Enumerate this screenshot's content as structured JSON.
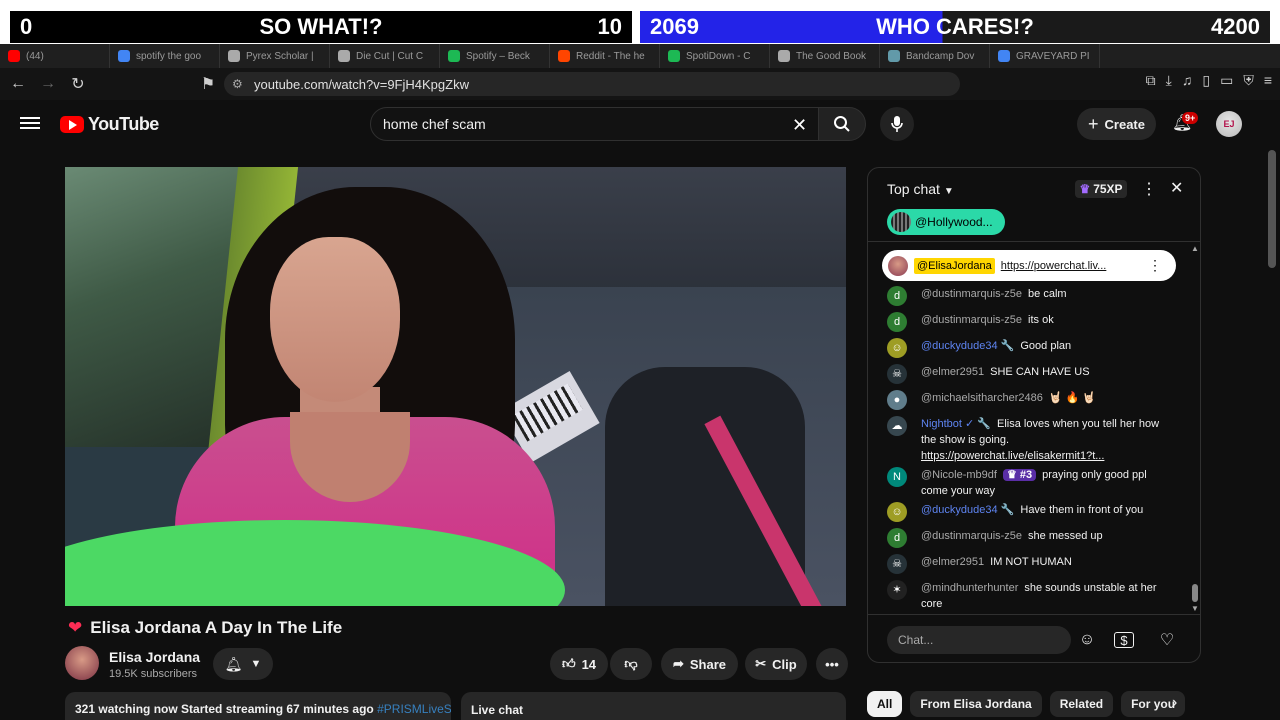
{
  "scoreboard": {
    "left": {
      "score_a": "0",
      "title": "SO WHAT!?",
      "score_b": "10"
    },
    "right": {
      "score_a": "2069",
      "title": "WHO CARES!?",
      "score_b": "4200"
    }
  },
  "tabs": [
    {
      "label": "(44)",
      "color": "#ff0000"
    },
    {
      "label": "spotify the goo",
      "color": "#4285f4"
    },
    {
      "label": "Pyrex Scholar |",
      "color": "#aaaaaa"
    },
    {
      "label": "Die Cut | Cut C",
      "color": "#aaaaaa"
    },
    {
      "label": "Spotify – Beck",
      "color": "#1db954"
    },
    {
      "label": "Reddit - The he",
      "color": "#ff4500"
    },
    {
      "label": "SpotiDown - C",
      "color": "#1db954"
    },
    {
      "label": "The Good Book",
      "color": "#aaaaaa"
    },
    {
      "label": "Bandcamp Dov",
      "color": "#629aa9"
    },
    {
      "label": "GRAVEYARD PI",
      "color": "#4285f4"
    }
  ],
  "browser": {
    "url": "youtube.com/watch?v=9FjH4KpgZkw"
  },
  "header": {
    "logo_text": "YouTube",
    "search_query": "home chef scam",
    "create_label": "Create",
    "notif_count": "9+"
  },
  "video": {
    "title": "Elisa Jordana A Day In The Life",
    "channel": "Elisa Jordana",
    "subscribers": "19.5K subscribers",
    "likes": "14",
    "share_label": "Share",
    "clip_label": "Clip",
    "info_bar": "321 watching now  Started streaming 67 minutes ago",
    "info_tag": "#PRISMLiveSt",
    "live_chat_label": "Live chat"
  },
  "chat": {
    "header": "Top chat",
    "xp": "75XP",
    "hollywood": "@Hollywood...",
    "pinned_author": "@ElisaJordana",
    "pinned_link": "https://powerchat.liv...",
    "input_placeholder": "Chat...",
    "messages": [
      {
        "author": "@dustinmarquis-z5e",
        "text": "be calm",
        "av": "d",
        "av_color": "#2e7d32"
      },
      {
        "author": "@dustinmarquis-z5e",
        "text": "its ok",
        "av": "d",
        "av_color": "#2e7d32"
      },
      {
        "author": "@duckydude34 🔧",
        "text": "Good plan",
        "av": "☺",
        "av_color": "#9e9d24",
        "mod": true
      },
      {
        "author": "@elmer2951",
        "text": "SHE CAN HAVE US",
        "av": "☠",
        "av_color": "#263238"
      },
      {
        "author": "@michaelsitharcher2486",
        "text": "🤘🏻 🔥 🤘🏻",
        "av": "●",
        "av_color": "#607d8b"
      },
      {
        "author": "Nightbot ✓ 🔧",
        "text": "Elisa loves when you tell her how the show is going. ",
        "link": "https://powerchat.live/elisakermit1?t...",
        "av": "☁",
        "av_color": "#37474f",
        "mod": true
      },
      {
        "author": "@Nicole-mb9df",
        "badge": "♛ #3",
        "text": "praying only good ppl come your way",
        "av": "N",
        "av_color": "#00897b"
      },
      {
        "author": "@duckydude34 🔧",
        "text": "Have them in front of you",
        "av": "☺",
        "av_color": "#9e9d24",
        "mod": true
      },
      {
        "author": "@dustinmarquis-z5e",
        "text": "she messed up",
        "av": "d",
        "av_color": "#2e7d32"
      },
      {
        "author": "@elmer2951",
        "text": "IM NOT HUMAN",
        "av": "☠",
        "av_color": "#263238"
      },
      {
        "author": "@mindhunterhunter",
        "text": "she sounds unstable at her core",
        "av": "✶",
        "av_color": "#212121"
      }
    ]
  },
  "chips": [
    "All",
    "From Elisa Jordana",
    "Related",
    "For you"
  ]
}
